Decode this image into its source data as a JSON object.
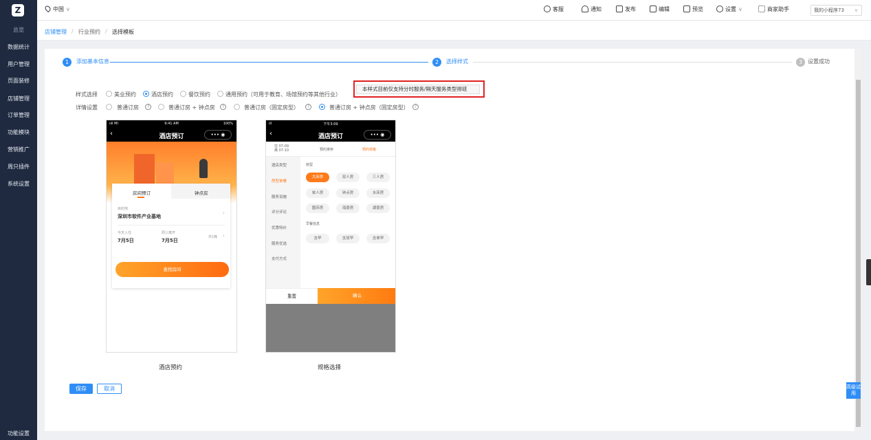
{
  "sidebar": {
    "logo": "Z",
    "items": [
      "总览",
      "数据统计",
      "用户管理",
      "页面装修",
      "店铺管理",
      "订单管理",
      "功能模块",
      "营销推广",
      "周只插件",
      "系统设置"
    ],
    "bottom": "功能设置"
  },
  "topbar": {
    "location": "中国",
    "location_arrow": "∨",
    "service": "客服",
    "notify": "通知",
    "publish": "发布",
    "edit": "编辑",
    "preview": "预览",
    "settings": "设置",
    "settings_arrow": "∨",
    "assistant": "商家助手",
    "app_select": "我的小程序73",
    "app_arrow": "∨"
  },
  "breadcrumb": {
    "items": [
      "店铺管理",
      "行业预约",
      "选择模板"
    ],
    "sep": "/"
  },
  "steps": [
    {
      "num": "1",
      "label": "添加基本信息"
    },
    {
      "num": "2",
      "label": "选择样式"
    },
    {
      "num": "3",
      "label": "设置成功"
    }
  ],
  "form": {
    "style_label": "样式选择",
    "style_options": [
      "美业预约",
      "酒店预约",
      "餐饮预约",
      "通用预约（可用于教育、场馆预约等其他行业）"
    ],
    "style_selected": 1,
    "detail_label": "详情设置",
    "detail_options": [
      "普通订房",
      "普通订房 + 钟点房",
      "普通订房（固定房型）",
      "普通订房 + 钟点房（固定房型）"
    ],
    "detail_selected": 3,
    "help_mark": "?"
  },
  "tooltip": "本样式目前仅支持分时服务/隔天服务类型排班",
  "phone1": {
    "caption": "酒店预约",
    "status_left": "ııll MI",
    "status_time": "9:41 AM",
    "status_right": "100%",
    "title": "酒店预订",
    "tab_room": "房间预订",
    "tab_hour": "钟点房",
    "dest_label": "目的地",
    "dest_value": "深圳市软件产业基地",
    "checkin_label": "今天入住",
    "checkin_date": "7月5日",
    "checkout_label": "周三离开",
    "checkout_date": "7月5日",
    "nights": "共1晚",
    "search_btn": "查找房间"
  },
  "phone2": {
    "caption": "规格选择",
    "status_left": "ıll",
    "status_time": "下午3:09",
    "title": "酒店预订",
    "date_in": "住 07-09",
    "date_out": "离 07-10",
    "sort": "预约排序",
    "spec": "预约规格",
    "cats": [
      "酒店类型",
      "房型单餐",
      "服务设施",
      "评分评论",
      "优惠特价",
      "服务优选",
      "支付方式"
    ],
    "room_type_label": "房型",
    "room_types": [
      "大床房",
      "双人房",
      "三人房",
      "单人房",
      "钟点房",
      "水床房",
      "圆床房",
      "海景房",
      "湖景房"
    ],
    "breakfast_label": "早餐信息",
    "breakfasts": [
      "含早",
      "含双早",
      "含单早"
    ],
    "reset": "重置",
    "confirm": "确认"
  },
  "buttons": {
    "save": "保存",
    "cancel": "取消"
  },
  "float_btn": "高级试用",
  "colors": {
    "accent": "#2f8ef6",
    "orange": "#ff7a1a",
    "sidebar": "#1f2a40",
    "red": "#e02020"
  }
}
